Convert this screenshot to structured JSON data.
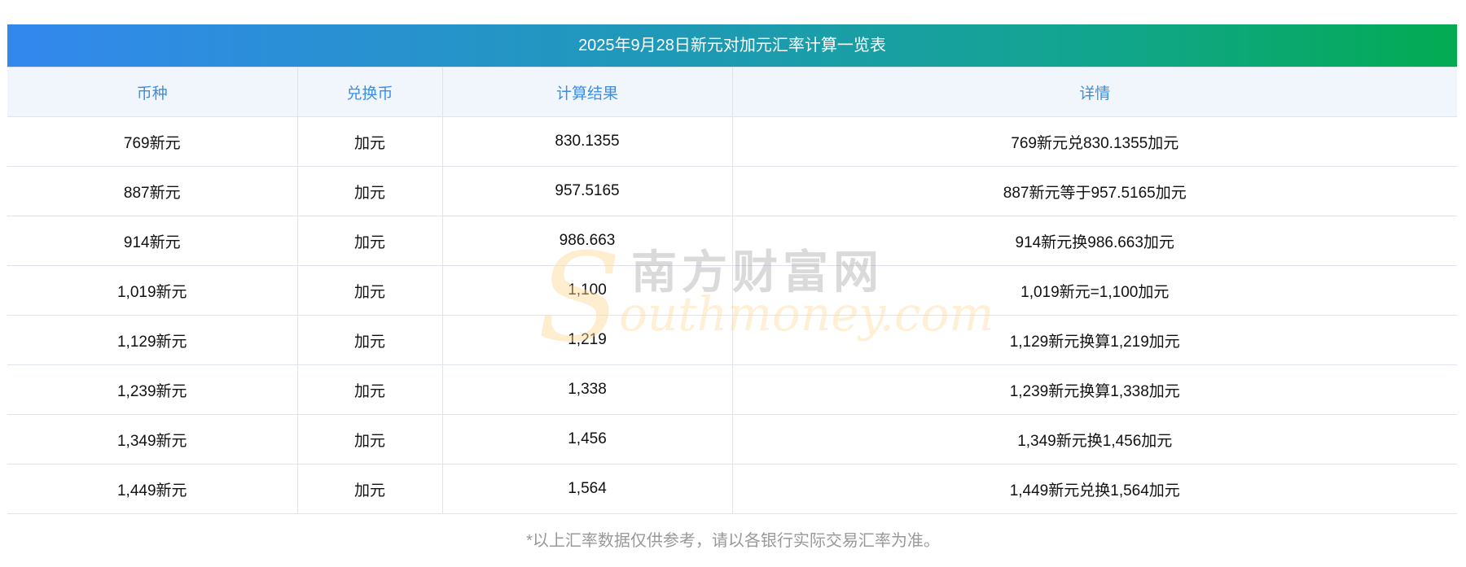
{
  "title": "2025年9月28日新元对加元汇率计算一览表",
  "headers": [
    "币种",
    "兑换币",
    "计算结果",
    "详情"
  ],
  "rows": [
    [
      "769新元",
      "加元",
      "830.1355",
      "769新元兑830.1355加元"
    ],
    [
      "887新元",
      "加元",
      "957.5165",
      "887新元等于957.5165加元"
    ],
    [
      "914新元",
      "加元",
      "986.663",
      "914新元换986.663加元"
    ],
    [
      "1,019新元",
      "加元",
      "1,100",
      "1,019新元=1,100加元"
    ],
    [
      "1,129新元",
      "加元",
      "1,219",
      "1,129新元换算1,219加元"
    ],
    [
      "1,239新元",
      "加元",
      "1,338",
      "1,239新元换算1,338加元"
    ],
    [
      "1,349新元",
      "加元",
      "1,456",
      "1,349新元换1,456加元"
    ],
    [
      "1,449新元",
      "加元",
      "1,564",
      "1,449新元兑换1,564加元"
    ]
  ],
  "watermark": {
    "cn": "南方财富网",
    "en": "Southmoney.com"
  },
  "note": "*以上汇率数据仅供参考，请以各银行实际交易汇率为准。"
}
